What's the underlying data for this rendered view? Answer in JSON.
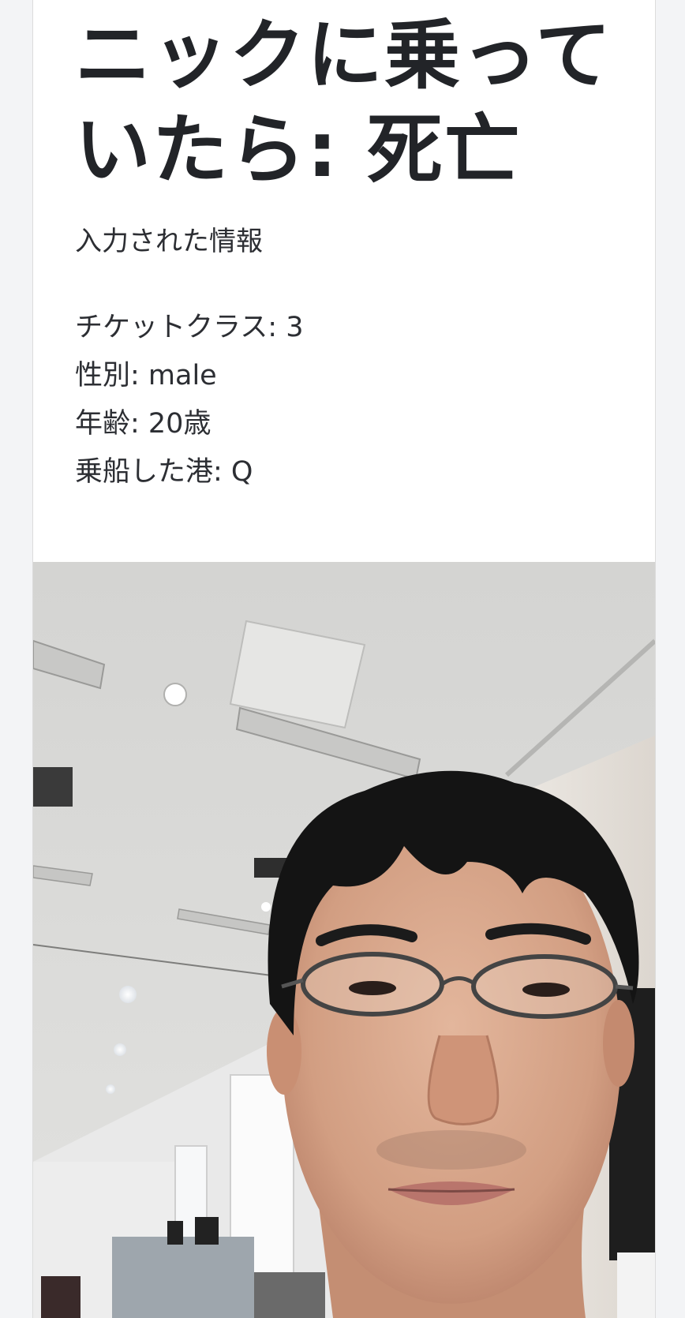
{
  "result": {
    "headline": "ニックに乗っていたら: 死亡"
  },
  "input_section": {
    "heading": "入力された情報",
    "items": [
      "チケットクラス: 3",
      "性別: male",
      "年齢: 20歳",
      "乗船した港: Q"
    ]
  },
  "photo": {
    "subject": "selfie-photo",
    "colors": {
      "ceiling": "#d9d9d7",
      "wall": "#e8e4df",
      "hair": "#141414",
      "skin": "#d9a68b",
      "speaker": "#1e1e1e"
    }
  }
}
